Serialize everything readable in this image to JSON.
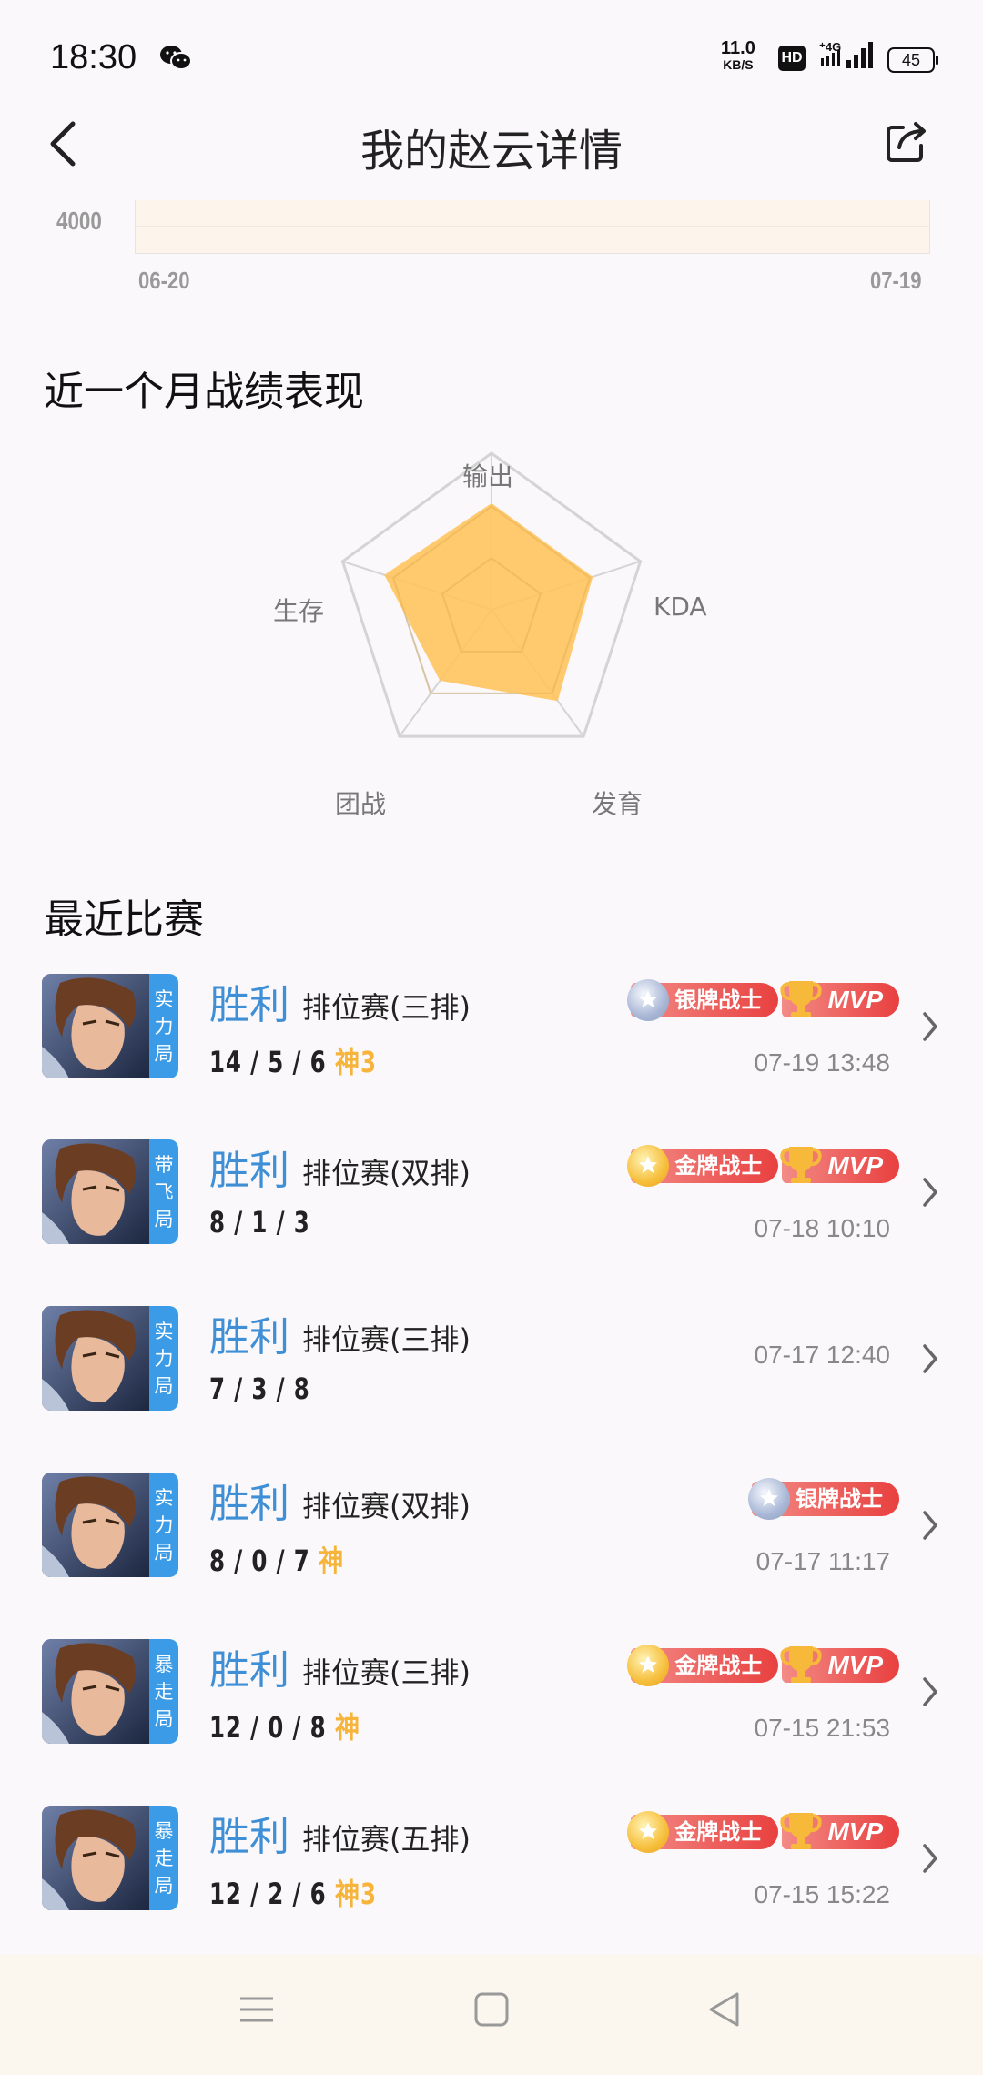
{
  "status": {
    "time": "18:30",
    "net_speed": "11.0",
    "net_unit": "KB/S",
    "hd": "HD",
    "network": "4G",
    "battery": "45"
  },
  "header": {
    "title": "我的赵云详情"
  },
  "chart_data": {
    "type": "line",
    "ytick": "4000",
    "x_start": "06-20",
    "x_end": "07-19"
  },
  "performance": {
    "title": "近一个月战绩表现",
    "axes": [
      "输出",
      "KDA",
      "发育",
      "团战",
      "生存"
    ],
    "values": [
      0.68,
      0.68,
      0.72,
      0.56,
      0.72
    ],
    "fill_color": "#ffc45e"
  },
  "recent": {
    "title": "最近比赛",
    "matches": [
      {
        "tag": "实力局",
        "result": "胜利",
        "mode": "排位赛(三排)",
        "kda": "14 / 5 / 6",
        "god": "神",
        "god_count": "3",
        "badges": [
          "银牌战士",
          "MVP"
        ],
        "time": "07-19 13:48"
      },
      {
        "tag": "带飞局",
        "result": "胜利",
        "mode": "排位赛(双排)",
        "kda": "8 / 1 / 3",
        "god": "",
        "god_count": "",
        "badges": [
          "金牌战士",
          "MVP"
        ],
        "time": "07-18 10:10"
      },
      {
        "tag": "实力局",
        "result": "胜利",
        "mode": "排位赛(三排)",
        "kda": "7 / 3 / 8",
        "god": "",
        "god_count": "",
        "badges": [],
        "time": "07-17 12:40"
      },
      {
        "tag": "实力局",
        "result": "胜利",
        "mode": "排位赛(双排)",
        "kda": "8 / 0 / 7",
        "god": "神",
        "god_count": "",
        "badges": [
          "银牌战士"
        ],
        "time": "07-17 11:17"
      },
      {
        "tag": "暴走局",
        "result": "胜利",
        "mode": "排位赛(三排)",
        "kda": "12 / 0 / 8",
        "god": "神",
        "god_count": "",
        "badges": [
          "金牌战士",
          "MVP"
        ],
        "time": "07-15 21:53"
      },
      {
        "tag": "暴走局",
        "result": "胜利",
        "mode": "排位赛(五排)",
        "kda": "12 / 2 / 6",
        "god": "神",
        "god_count": "3",
        "badges": [
          "金牌战士",
          "MVP"
        ],
        "time": "07-15 15:22"
      }
    ]
  },
  "colors": {
    "accent": "#3f8fd6",
    "god": "#f6b43a",
    "tag_bg": "#3c9be6",
    "badge_red": "#e8403f"
  }
}
